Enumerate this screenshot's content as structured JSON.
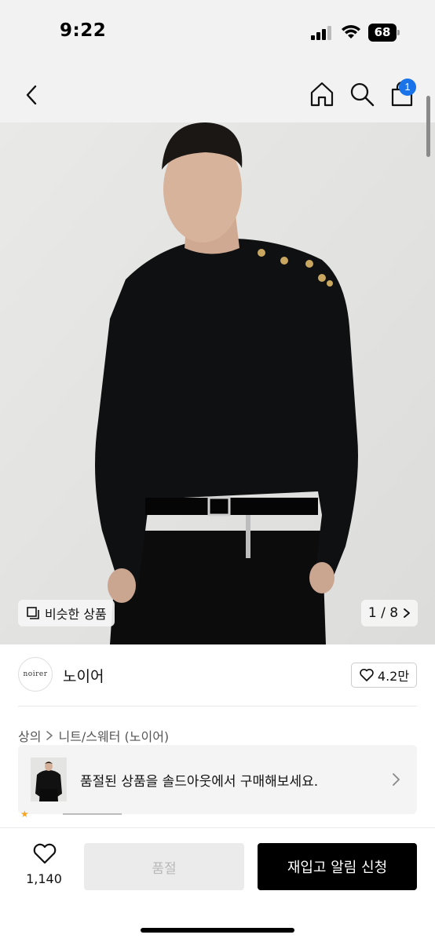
{
  "status_bar": {
    "time": "9:22",
    "battery": "68",
    "icons": [
      "signal-icon",
      "wifi-icon",
      "battery-icon"
    ]
  },
  "header": {
    "icons": [
      "back-icon",
      "home-icon",
      "search-icon",
      "cart-icon"
    ],
    "cart_badge": "1"
  },
  "gallery": {
    "similar_label": "비슷한 상품",
    "pager": "1 / 8"
  },
  "brand": {
    "logo_text": "noirer",
    "name": "노이어",
    "likes": "4.2만"
  },
  "breadcrumb": {
    "category": "상의",
    "subcategory": "니트/스웨터 (노이어)"
  },
  "soldout_banner": {
    "text": "품절된 상품을 솔드아웃에서 구매해보세요."
  },
  "bottom_bar": {
    "wish_count": "1,140",
    "soldout_label": "품절",
    "restock_label": "재입고 알림 신청"
  },
  "colors": {
    "badge": "#1a73e8",
    "primary_button": "#000000",
    "disabled_button": "#ebebeb"
  }
}
